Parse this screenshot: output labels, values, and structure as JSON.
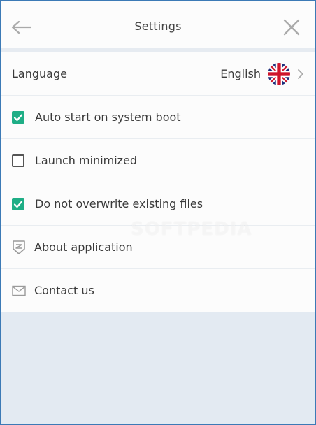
{
  "header": {
    "title": "Settings",
    "back_icon": "arrow-left-icon",
    "close_icon": "close-icon"
  },
  "language": {
    "label": "Language",
    "value": "English",
    "flag_icon": "uk-flag-icon",
    "chevron_icon": "chevron-right-icon"
  },
  "options": [
    {
      "label": "Auto start on system boot",
      "checked": true
    },
    {
      "label": "Launch minimized",
      "checked": false
    },
    {
      "label": "Do not overwrite existing files",
      "checked": true
    }
  ],
  "links": {
    "about": {
      "label": "About application",
      "icon": "shield-logo-icon"
    },
    "contact": {
      "label": "Contact us",
      "icon": "envelope-icon"
    }
  },
  "watermark": "SOFTPEDIA",
  "colors": {
    "accent": "#1fae86",
    "background": "#e3eaf2",
    "panel": "#fcfcfc",
    "text": "#3a3a3a"
  }
}
